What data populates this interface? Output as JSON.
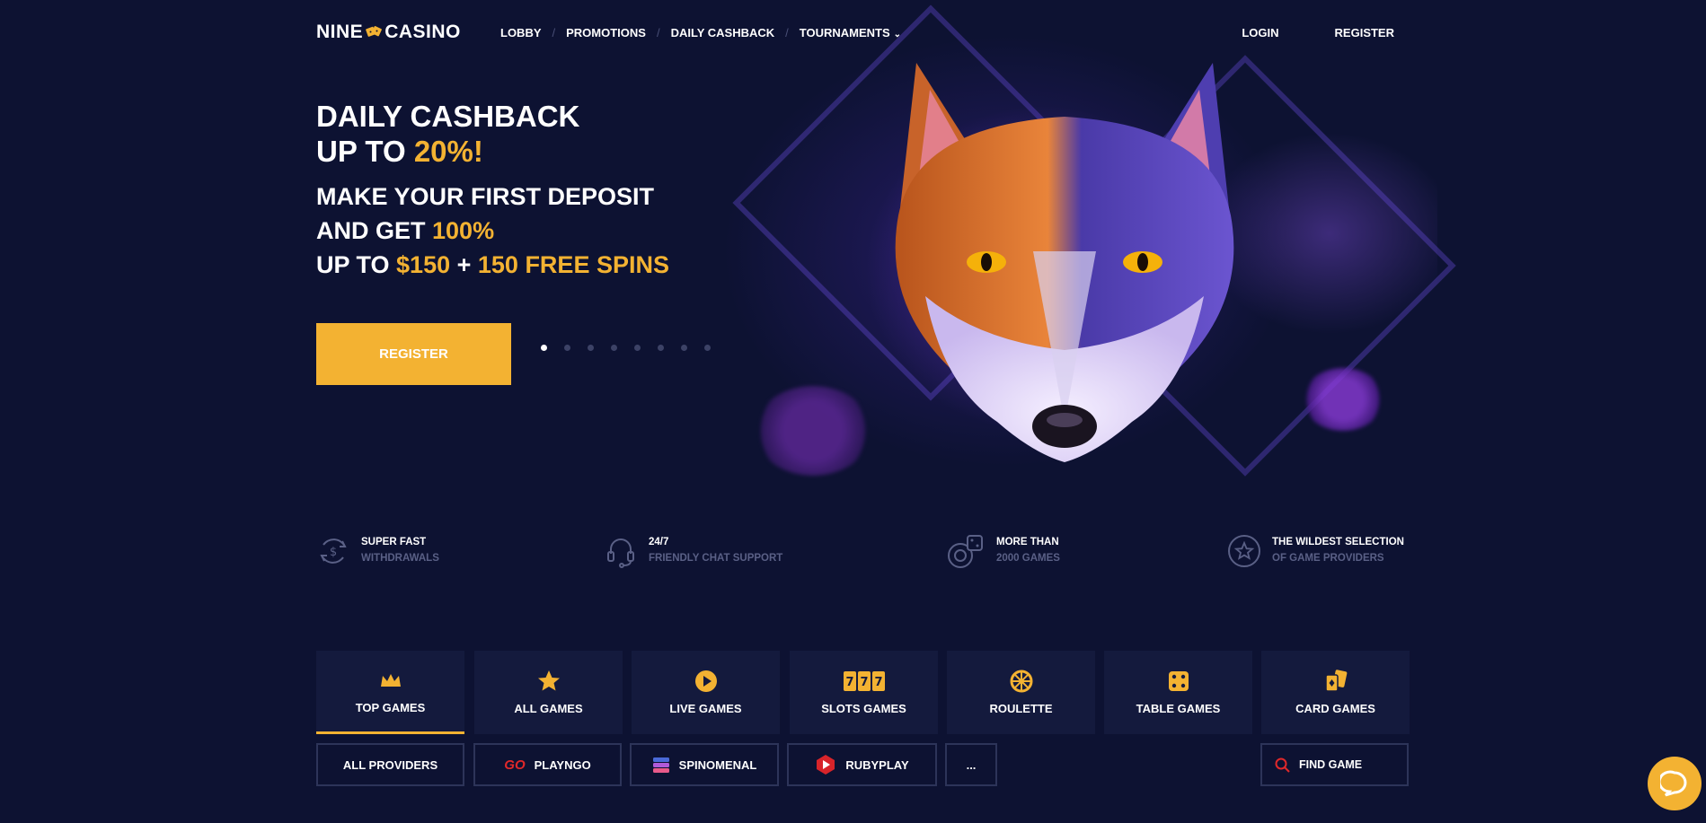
{
  "header": {
    "logo_left": "NINE",
    "logo_right": "CASINO",
    "nav": [
      {
        "label": "LOBBY"
      },
      {
        "label": "PROMOTIONS"
      },
      {
        "label": "DAILY CASHBACK"
      },
      {
        "label": "TOURNAMENTS"
      }
    ],
    "login": "LOGIN",
    "register": "REGISTER"
  },
  "hero": {
    "title_line1": "DAILY CASHBACK",
    "title_line2_prefix": "UP TO ",
    "title_line2_highlight": "20%!",
    "sub_line1": "MAKE YOUR FIRST DEPOSIT",
    "sub_line2_prefix": "AND GET ",
    "sub_line2_highlight": "100%",
    "sub_line3_prefix": "UP TO ",
    "sub_line3_amount": "$150",
    "sub_line3_plus": " + ",
    "sub_line3_spins": "150 FREE SPINS",
    "register_button": "REGISTER",
    "slides_total": 8,
    "slide_active": 1
  },
  "features": [
    {
      "title": "SUPER FAST",
      "subtitle": "WITHDRAWALS",
      "icon": "dollar-refresh-icon"
    },
    {
      "title": "24/7",
      "subtitle": "FRIENDLY CHAT SUPPORT",
      "icon": "headset-icon"
    },
    {
      "title": "MORE THAN",
      "subtitle": "2000 GAMES",
      "icon": "chip-dice-icon"
    },
    {
      "title": "THE WILDEST SELECTION",
      "subtitle": "OF GAME PROVIDERS",
      "icon": "star-circle-icon"
    }
  ],
  "categories": [
    {
      "label": "TOP GAMES",
      "icon": "crown-icon",
      "active": true
    },
    {
      "label": "ALL GAMES",
      "icon": "star-icon",
      "active": false
    },
    {
      "label": "LIVE GAMES",
      "icon": "play-icon",
      "active": false
    },
    {
      "label": "SLOTS GAMES",
      "icon": "slots-777-icon",
      "active": false
    },
    {
      "label": "ROULETTE",
      "icon": "roulette-icon",
      "active": false
    },
    {
      "label": "TABLE GAMES",
      "icon": "dice-icon",
      "active": false
    },
    {
      "label": "CARD GAMES",
      "icon": "cards-icon",
      "active": false
    }
  ],
  "providers": [
    {
      "label": "ALL PROVIDERS"
    },
    {
      "label": "PLAYNGO",
      "icon": "playngo-logo-icon",
      "badge": "GO"
    },
    {
      "label": "SPINOMENAL",
      "icon": "spinomenal-logo-icon"
    },
    {
      "label": "RUBYPLAY",
      "icon": "rubyplay-logo-icon"
    },
    {
      "label": "..."
    }
  ],
  "search": {
    "placeholder": "FIND GAME"
  },
  "colors": {
    "accent": "#f3b232",
    "background": "#0d1232",
    "tile": "#141a3d",
    "border": "#2d3459"
  }
}
